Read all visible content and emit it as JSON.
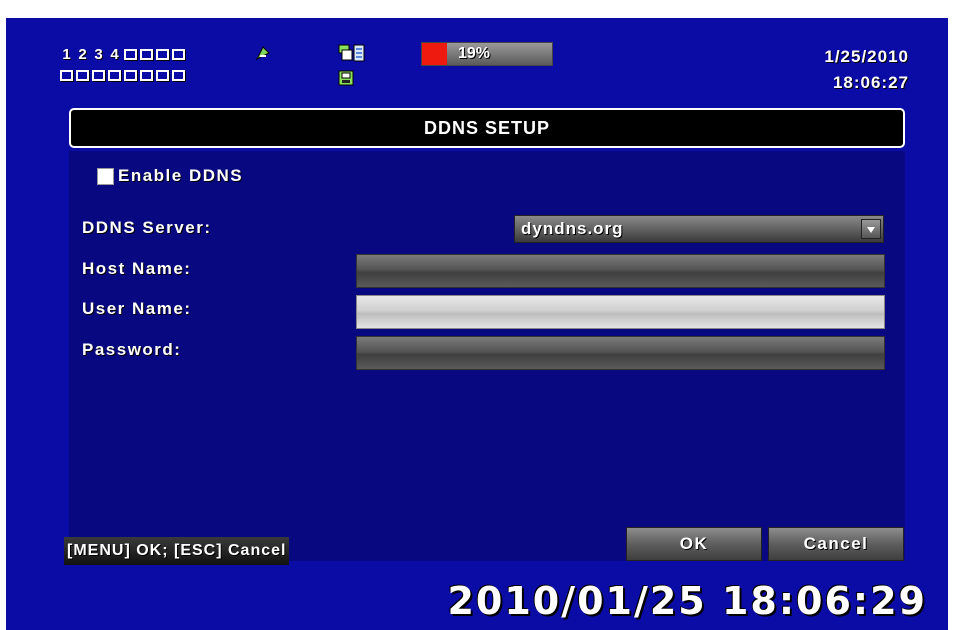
{
  "status": {
    "channels": [
      "1",
      "2",
      "3",
      "4"
    ],
    "hdd_usage_percent": 19,
    "hdd_usage_text": "19%",
    "date": "1/25/2010",
    "time": "18:06:27"
  },
  "dialog": {
    "title": "DDNS SETUP",
    "enable_label": "Enable DDNS",
    "server_label": "DDNS Server:",
    "server_value": "dyndns.org",
    "host_label": "Host Name:",
    "user_label": "User Name:",
    "password_label": "Password:",
    "host_value": "",
    "user_value": "",
    "password_value": ""
  },
  "footer": {
    "hint": "[MENU] OK; [ESC] Cancel",
    "ok_label": "OK",
    "cancel_label": "Cancel",
    "timestamp": "2010/01/25  18:06:29"
  },
  "colors": {
    "background": "#0b0ba6",
    "panel": "#080880",
    "hdd_fill": "#ee1a10"
  },
  "icons": [
    "network-icon",
    "record-status-icon",
    "storage-icon",
    "dropdown-arrow-icon"
  ]
}
